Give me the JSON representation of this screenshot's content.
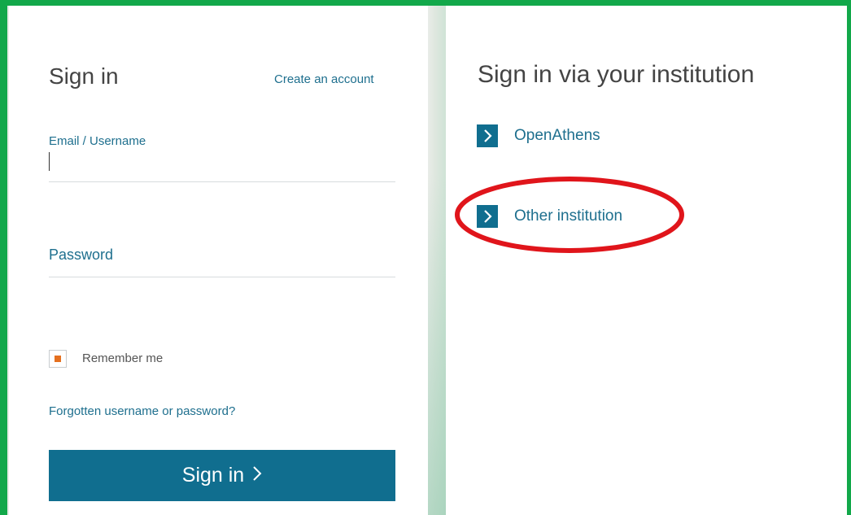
{
  "signin": {
    "title": "Sign in",
    "create_account": "Create an account",
    "email_label": "Email / Username",
    "password_label": "Password",
    "remember_me": "Remember me",
    "remember_checked": true,
    "forgot": "Forgotten username or password?",
    "button_label": "Sign in"
  },
  "institution": {
    "title": "Sign in via your institution",
    "options": [
      {
        "label": "OpenAthens"
      },
      {
        "label": "Other institution"
      }
    ]
  },
  "colors": {
    "accent": "#106e8f",
    "link": "#1e6f8e",
    "frame": "#12a84a",
    "highlight": "#e0151b",
    "checkbox_fill": "#e5701f"
  },
  "icons": {
    "option_chevron": "chevron-right-icon",
    "button_chevron": "chevron-right-icon"
  }
}
